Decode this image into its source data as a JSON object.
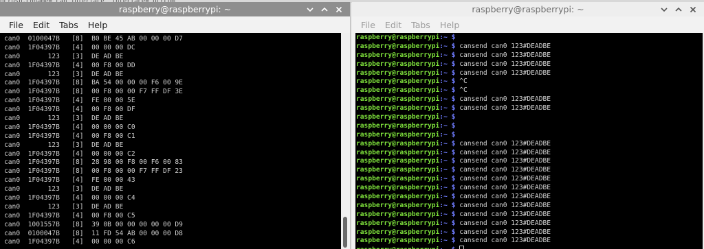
{
  "background_strip": "ocrusb.chname='can interface' interface='ocrcom'",
  "left_window": {
    "title": "raspberry@raspberrypi: ~",
    "menu": [
      "File",
      "Edit",
      "Tabs",
      "Help"
    ],
    "candump_lines": [
      "can0  0100047B   [8]  B0 BE 45 AB 00 00 00 D7",
      "can0  1F04397B   [4]  00 00 00 DC",
      "can0       123   [3]  DE AD BE",
      "can0  1F04397B   [4]  00 F8 00 DD",
      "can0       123   [3]  DE AD BE",
      "can0  1F04397B   [8]  BA 54 00 00 00 F6 00 9E",
      "can0  1F04397B   [8]  00 F8 00 00 F7 FF DF 3E",
      "can0  1F04397B   [4]  FE 00 00 5E",
      "can0  1F04397B   [4]  00 F8 00 DF",
      "can0       123   [3]  DE AD BE",
      "can0  1F04397B   [4]  00 00 00 C0",
      "can0  1F04397B   [4]  00 F8 00 C1",
      "can0       123   [3]  DE AD BE",
      "can0  1F04397B   [4]  00 00 00 C2",
      "can0  1F04397B   [8]  28 98 00 F8 00 F6 00 83",
      "can0  1F04397B   [8]  00 F8 00 00 F7 FF DF 23",
      "can0  1F04397B   [4]  FE 00 00 43",
      "can0       123   [3]  DE AD BE",
      "can0  1F04397B   [4]  00 00 00 C4",
      "can0       123   [3]  DE AD BE",
      "can0  1F04397B   [4]  00 F8 00 C5",
      "can0  1001557B   [8]  39 0B 00 00 00 00 00 D9",
      "can0  0100047B   [8]  11 FD 54 AB 00 00 00 D8",
      "can0  1F04397B   [4]  00 00 00 C6"
    ]
  },
  "right_window": {
    "title": "raspberry@raspberrypi: ~",
    "menu": [
      "File",
      "Edit",
      "Tabs",
      "Help"
    ],
    "prompt_user": "raspberry@raspberrypi",
    "prompt_path": ":~ $",
    "commands": [
      "",
      "cansend can0 123#DEADBE",
      "cansend can0 123#DEADBE",
      "cansend can0 123#DEADBE",
      "cansend can0 123#DEADBE",
      "^C",
      "^C",
      "cansend can0 123#DEADBE",
      "cansend can0 123#DEADBE",
      "",
      "",
      "",
      "cansend can0 123#DEADBE",
      "cansend can0 123#DEADBE",
      "cansend can0 123#DEADBE",
      "cansend can0 123#DEADBE",
      "cansend can0 123#DEADBE",
      "cansend can0 123#DEADBE",
      "cansend can0 123#DEADBE",
      "cansend can0 123#DEADBE",
      "cansend can0 123#DEADBE",
      "cansend can0 123#DEADBE",
      "cansend can0 123#DEADBE",
      "cansend can0 123#DEADBE",
      ""
    ]
  },
  "colors": {
    "prompt_user": "#7fe33c",
    "prompt_path": "#6f7cff",
    "terminal_bg": "#000000",
    "active_titlebar": "#8e8e8e",
    "inactive_titlebar": "#eeeeee"
  },
  "icons": {
    "minimize": "chevron-down-icon",
    "maximize": "chevron-up-icon",
    "close": "close-icon"
  }
}
